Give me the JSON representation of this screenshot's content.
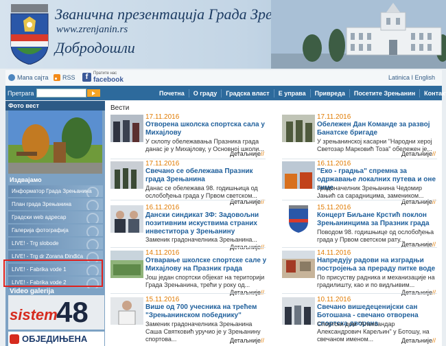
{
  "header": {
    "title": "Званична презентација Града Зрењанина",
    "url": "www.zrenjanin.rs",
    "welcome": "Добродошли"
  },
  "utility": {
    "home_label": "Мапа сајта",
    "rss_label": "RSS",
    "fb_small": "Пратите нас",
    "fb_label": "facebook",
    "languages": "Latinica I English"
  },
  "search": {
    "label": "Претрага",
    "value": ""
  },
  "nav": [
    "Почетна",
    "О граду",
    "Градска власт",
    "Е управа",
    "Привреда",
    "Посетите Зрењанин",
    "Контакт"
  ],
  "sidebar": {
    "photo_title": "Фото вест",
    "featured_title": "Издвајамо",
    "items": [
      "Информатор Града Зрењанина",
      "План града Зрењанина",
      "Градски web адресар",
      "Галерија фотографија",
      "LIVE! - Trg slobode",
      "LIVE! - Trg dr Zorana Đinđića",
      "LIVE! - Fabrika vode 1",
      "LIVE! - Fabrika vode 2"
    ],
    "video_label": "Video galerija",
    "banner1_text": "sistem",
    "banner1_num": "48",
    "banner2_text": "ОБЈЕДИЊЕНА"
  },
  "main": {
    "section_title": "Вести",
    "more_label": "Детаљније",
    "news_left": [
      {
        "date": "17.11.2016",
        "title": "Отворена школска спортска сала у Михајлову",
        "snippet": "У склопу обележавања Празника града данас је у Михајлову, у Основној школи..."
      },
      {
        "date": "17.11.2016",
        "title": "Свечано се обележава Празник града Зрењанина",
        "snippet": "Данас се обележава 98. годишњица од ослобођења града у Првом светском..."
      },
      {
        "date": "16.11.2016",
        "title": "Дански синдикат 3Ф: Задовољни позитивним искуствима страних инвеститора у Зрењанину",
        "snippet": "Заменик градоначелника Зрењанина..."
      },
      {
        "date": "14.11.2016",
        "title": "Отварање школске спортске сале у Михајлову на Празник града",
        "snippet": "Још један спортски објекат на територији Града Зрењанина, трећи у року од..."
      },
      {
        "date": "15.11.2016",
        "title": "Више од 700 учесника на трећем \"Зрењанинском победнику\"",
        "snippet": "Заменик градоначелника Зрењанина Саша Святковић уручио је у Зрењанину спортова..."
      }
    ],
    "news_right": [
      {
        "date": "17.11.2016",
        "title": "Обележен Дан Команде за развој Банатске бригаде",
        "snippet": "У зрењанинској касарни \"Народни херој Светозар Марковић Тоза\" обележен је..."
      },
      {
        "date": "16.11.2016",
        "title": "\"Еко - градња\" спремна за одржавање локалних путева и оне зиме",
        "snippet": "Градоначелник Зрењанина Чедомир Јањић са сарадницима, замеником..."
      },
      {
        "date": "15.11.2016",
        "title": "Концерт Биљане Крстић поклон Зрењанинцима за Празник града",
        "snippet": "Поводом 98. годишњице од ослобођења града у Првом светском рату..."
      },
      {
        "date": "14.11.2016",
        "title": "Напредују радови на изградњи постројења за прераду питке воде",
        "snippet": "По присуству радника и механизације на градилишту, као и по видљивим..."
      },
      {
        "date": "10.11.2016",
        "title": "Свечано вишедеценијски сан Ботошана - свечано отворена спортска дворана",
        "snippet": "Спортски дом \"Александар Александрович Карељин\" у Ботошу, на свечаном именом..."
      }
    ]
  }
}
